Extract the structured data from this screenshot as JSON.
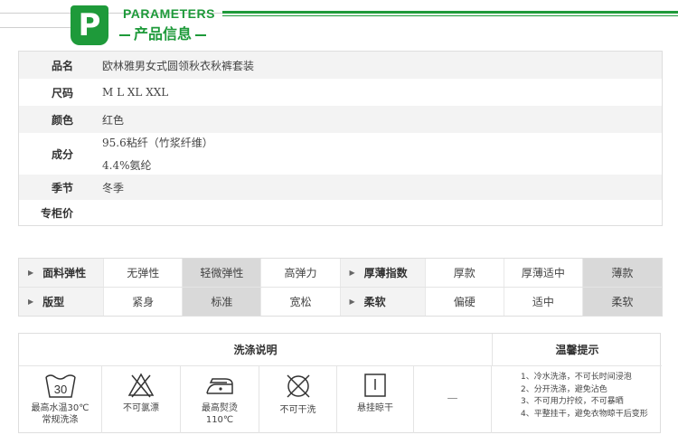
{
  "header": {
    "badge_letter": "P",
    "title_en": "PARAMETERS",
    "title_zh": "产品信息",
    "accent_color": "#1e9a3a"
  },
  "params": [
    {
      "label": "品名",
      "values": [
        "欧林雅男女式圆领秋衣秋裤套装"
      ]
    },
    {
      "label": "尺码",
      "values": [
        "M L XL XXL"
      ]
    },
    {
      "label": "颜色",
      "values": [
        "红色"
      ]
    },
    {
      "label": "成分",
      "values": [
        "95.6粘纤（竹浆纤维）",
        "4.4%氨纶"
      ]
    },
    {
      "label": "季节",
      "values": [
        "冬季"
      ]
    },
    {
      "label": "专柜价",
      "values": [
        ""
      ]
    }
  ],
  "attributes": [
    {
      "left": {
        "name": "面料弹性",
        "options": [
          "无弹性",
          "轻微弹性",
          "高弹力"
        ],
        "selected": 1
      },
      "right": {
        "name": "厚薄指数",
        "options": [
          "厚款",
          "厚薄适中",
          "薄款"
        ],
        "selected": 2
      }
    },
    {
      "left": {
        "name": "版型",
        "options": [
          "紧身",
          "标准",
          "宽松"
        ],
        "selected": 1
      },
      "right": {
        "name": "柔软",
        "options": [
          "偏硬",
          "适中",
          "柔软"
        ],
        "selected": 2
      }
    }
  ],
  "care": {
    "wash_title": "洗涤说明",
    "tips_title": "温馨提示",
    "symbols": [
      {
        "icon": "wash-30-icon",
        "number": "30",
        "caption": [
          "最高水温30℃",
          "常规洗涤"
        ]
      },
      {
        "icon": "no-bleach-icon",
        "caption": [
          "不可氯漂"
        ]
      },
      {
        "icon": "iron-110-icon",
        "caption": [
          "最高熨烫",
          "110℃"
        ]
      },
      {
        "icon": "no-dry-clean-icon",
        "caption": [
          "不可干洗"
        ]
      },
      {
        "icon": "hang-dry-icon",
        "caption": [
          "悬挂晾干"
        ]
      }
    ],
    "empty_mark": "—",
    "tips": [
      "1、冷水洗涤，不可长时间浸泡",
      "2、分开洗涤，避免沾色",
      "3、不可用力拧绞，不可暴晒",
      "4、平整挂干，避免衣物晾干后变形"
    ]
  }
}
